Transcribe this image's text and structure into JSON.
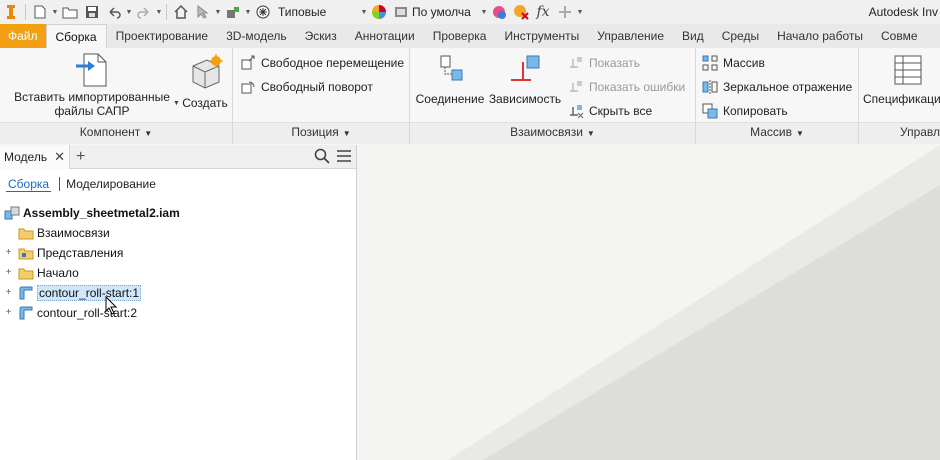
{
  "app": {
    "title": "Autodesk Inv"
  },
  "qat": {
    "style_value": "Типовые",
    "appearance_value": "По умолча"
  },
  "tabs": [
    "Файл",
    "Сборка",
    "Проектирование",
    "3D-модель",
    "Эскиз",
    "Аннотации",
    "Проверка",
    "Инструменты",
    "Управление",
    "Вид",
    "Среды",
    "Начало работы",
    "Совме"
  ],
  "ribbon": {
    "component": {
      "title": "Компонент",
      "place_imported": "Вставить импортированные",
      "place_imported_2": "файлы САПР",
      "create": "Создать"
    },
    "position": {
      "title": "Позиция",
      "free_move": "Свободное перемещение",
      "free_rotate": "Свободный поворот"
    },
    "relationships": {
      "title": "Взаимосвязи",
      "joint": "Соединение",
      "constrain": "Зависимость",
      "show": "Показать",
      "show_sick": "Показать ошибки",
      "hide_all": "Скрыть все"
    },
    "pattern": {
      "title": "Массив",
      "pattern": "Массив",
      "mirror": "Зеркальное отражение",
      "copy": "Копировать"
    },
    "manage": {
      "title": "Управл",
      "bom": "Спецификация"
    }
  },
  "browser": {
    "tab": "Модель",
    "modes": {
      "assembly": "Сборка",
      "modeling": "Моделирование"
    },
    "tree": {
      "root": "Assembly_sheetmetal2.iam",
      "relationships": "Взаимосвязи",
      "representations": "Представления",
      "origin": "Начало",
      "part1": "contour_roll-start:1",
      "part2": "contour_roll-start:2"
    }
  },
  "colors": {
    "file_tab": "#f3a013",
    "link": "#1a6bbf",
    "highlight": "#cfe6fb"
  }
}
